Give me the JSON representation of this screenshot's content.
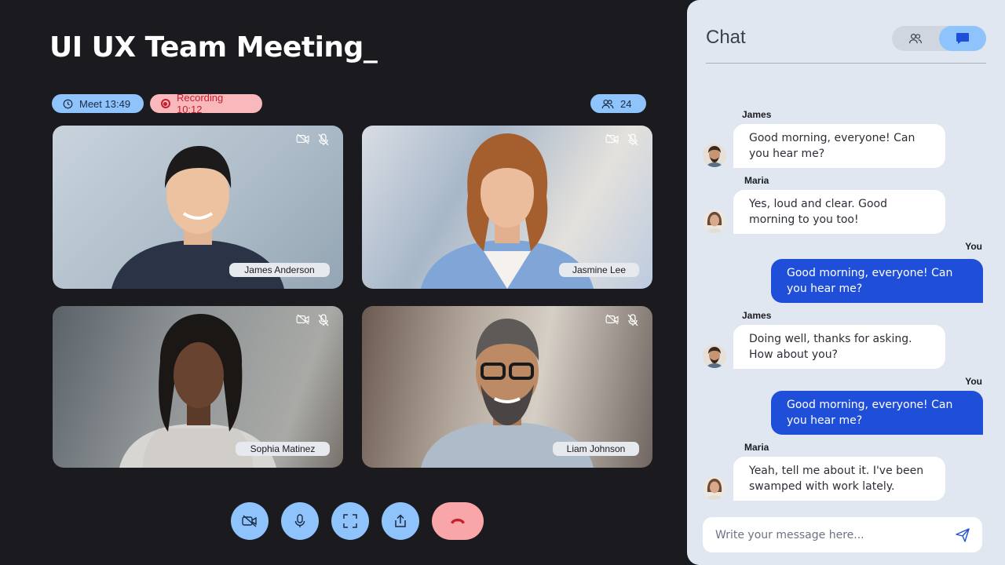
{
  "meeting": {
    "title": "UI UX Team Meeting_",
    "meet_label": "Meet 13:49",
    "recording_label": "Recording 10:12",
    "participants_count": "24"
  },
  "participants": [
    {
      "name": "James Anderson"
    },
    {
      "name": "Jasmine Lee"
    },
    {
      "name": "Sophia Matinez"
    },
    {
      "name": "Liam Johnson"
    }
  ],
  "controls": [
    "camera-off",
    "microphone",
    "fullscreen",
    "share",
    "end-call"
  ],
  "chat": {
    "title": "Chat",
    "input_placeholder": "Write your message here...",
    "messages": [
      {
        "sender": "James",
        "text": "Good morning, everyone! Can you hear me?",
        "mine": false
      },
      {
        "sender": "Maria",
        "text": "Yes, loud and clear. Good morning to you too!",
        "mine": false
      },
      {
        "sender": "You",
        "text": "Good morning, everyone! Can you hear me?",
        "mine": true
      },
      {
        "sender": "James",
        "text": "Doing well, thanks for asking. How about you?",
        "mine": false
      },
      {
        "sender": "You",
        "text": "Good morning, everyone! Can you hear me?",
        "mine": true
      },
      {
        "sender": "Maria",
        "text": "Yeah, tell me about it. I've been swamped with work lately.",
        "mine": false
      }
    ]
  },
  "colors": {
    "background": "#1b1b1f",
    "accent_light_blue": "#8fc3fb",
    "recording_red": "#c41f2f",
    "my_bubble": "#1f4fd8",
    "panel": "#e1e7f0"
  }
}
